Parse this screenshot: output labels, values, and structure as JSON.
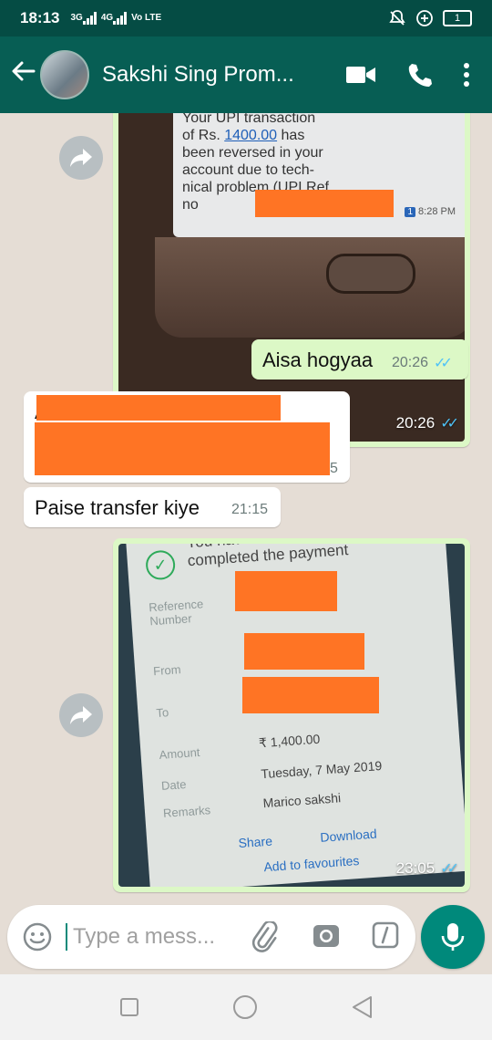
{
  "status_bar": {
    "time": "18:13",
    "network_1": "3G",
    "network_2": "4G",
    "volte": "Vo LTE",
    "battery": "1"
  },
  "header": {
    "back_icon": "arrow-back-icon",
    "contact_name": "Sakshi Sing Prom...",
    "video_icon": "video-call-icon",
    "call_icon": "phone-icon",
    "menu_icon": "more-vert-icon"
  },
  "messages": [
    {
      "type": "image",
      "direction": "outgoing",
      "time": "20:26",
      "status": "read",
      "photo": {
        "sms_line_1": "Your UPI transaction",
        "sms_line_2_prefix": "of Rs. ",
        "sms_amount": "1400.00",
        "sms_line_2_suffix": " has",
        "sms_line_3": "been reversed in your",
        "sms_line_4": "account due to tech-",
        "sms_line_5": "nical problem (UPI Ref",
        "sms_line_6": "no",
        "sim_badge": "1",
        "sms_time": "8:28 PM"
      }
    },
    {
      "type": "text",
      "direction": "outgoing",
      "text": "Aisa hogyaa",
      "time": "20:26",
      "status": "read"
    },
    {
      "type": "text",
      "direction": "incoming",
      "text": "A",
      "time_partial": "5",
      "redacted": true
    },
    {
      "type": "text",
      "direction": "incoming",
      "text": "Paise transfer kiye",
      "time": "21:15"
    },
    {
      "type": "image",
      "direction": "outgoing",
      "time": "23:05",
      "status": "read",
      "photo": {
        "heading_1": "You have succe",
        "heading_2": "completed the payment",
        "label_reference": "Reference Number",
        "label_from": "From",
        "label_to": "To",
        "label_amount": "Amount",
        "value_amount": "₹ 1,400.00",
        "label_date": "Date",
        "value_date": "Tuesday, 7 May 2019",
        "label_remarks": "Remarks",
        "value_remarks": "Marico sakshi",
        "action_share": "Share",
        "action_download": "Download",
        "action_favourites": "Add to favourites"
      }
    }
  ],
  "composer": {
    "placeholder": "Type a mess...",
    "emoji_icon": "emoji-icon",
    "attach_icon": "paperclip-icon",
    "camera_icon": "camera-icon",
    "payment_icon": "rupee-payment-icon",
    "mic_icon": "microphone-icon"
  },
  "colors": {
    "header": "#075e54",
    "status_bar": "#054c44",
    "chat_bg": "#e5ddd5",
    "outgoing_bubble": "#dcf8c6",
    "incoming_bubble": "#ffffff",
    "read_ticks": "#4fc3f7",
    "accent": "#00897b",
    "redaction": "#ff7424"
  }
}
